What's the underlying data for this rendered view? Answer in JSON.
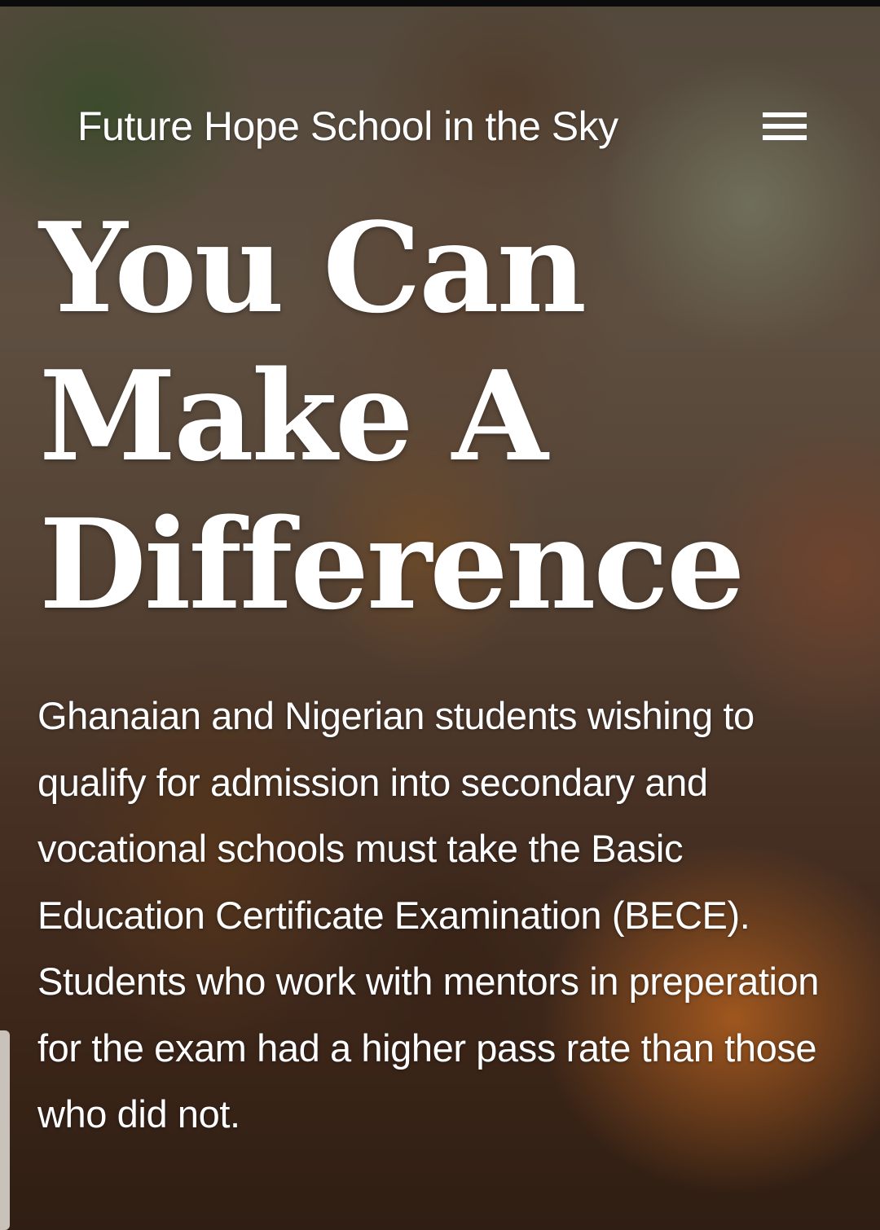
{
  "header": {
    "site_title": "Future Hope School in the Sky",
    "menu_icon": "hamburger-menu-icon"
  },
  "hero": {
    "headline_lines": [
      "You Can",
      "Make A",
      "Difference"
    ],
    "intro_text": "Ghanaian and Nigerian students wishing to qualify for admission into secondary and vocational schools must take the Basic Education Certificate Examination (BECE). Students who work with mentors in preperation for the exam had a higher pass rate than those who did not."
  },
  "colors": {
    "text": "#ffffff",
    "accent_orange": "#dc7828"
  }
}
